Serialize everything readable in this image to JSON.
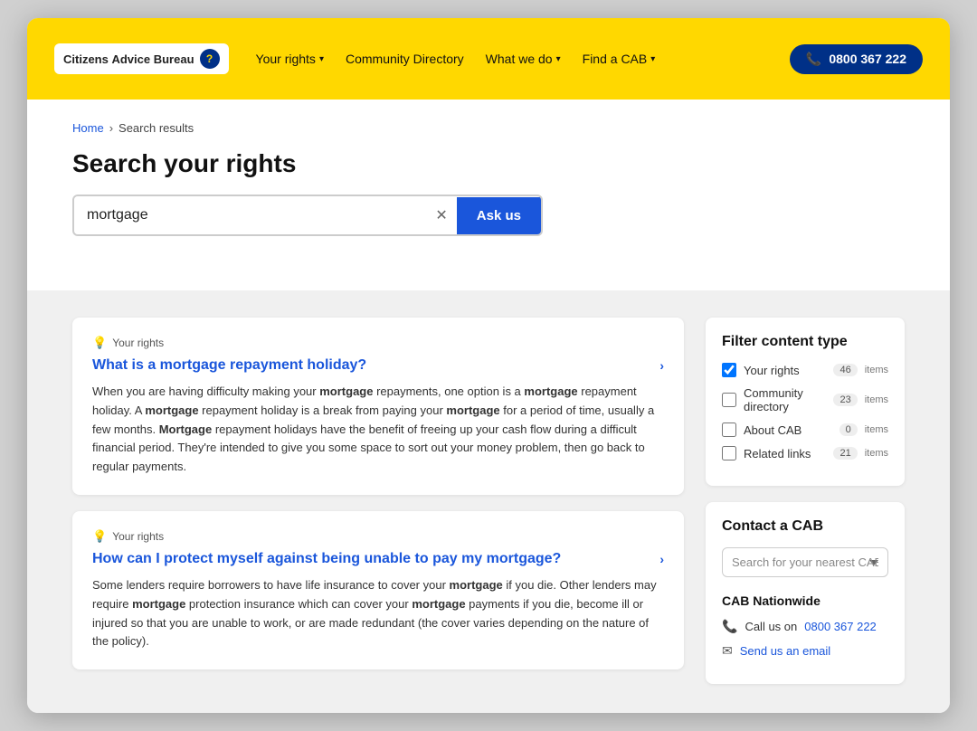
{
  "logo": {
    "name": "Citizens Advice Bureau",
    "icon_char": "?",
    "parts": [
      "Citizens ",
      "Advice ",
      "Bureau"
    ]
  },
  "nav": {
    "items": [
      {
        "id": "your-rights",
        "label": "Your rights",
        "has_dropdown": true
      },
      {
        "id": "community-directory",
        "label": "Community Directory",
        "has_dropdown": false
      },
      {
        "id": "what-we-do",
        "label": "What we do",
        "has_dropdown": true
      },
      {
        "id": "find-a-cab",
        "label": "Find a CAB",
        "has_dropdown": true
      }
    ],
    "phone": {
      "label": "0800 367 222",
      "display": "📞 0800 367 222"
    }
  },
  "breadcrumb": {
    "home": "Home",
    "separator": "›",
    "current": "Search results"
  },
  "search": {
    "title": "Search your rights",
    "value": "mortgage",
    "clear_label": "✕",
    "button_label": "Ask us"
  },
  "results": [
    {
      "tag": "Your rights",
      "title": "What is a mortgage repayment holiday?",
      "body_html": "When you are having difficulty making your <strong>mortgage</strong> repayments, one option is a <strong>mortgage</strong> repayment holiday. A <strong>mortgage</strong> repayment holiday is a break from paying your <strong>mortgage</strong> for a period of time, usually a few months. <strong>Mortgage</strong> repayment holidays have the benefit of freeing up your cash flow during a difficult financial period. They're intended to give you some space to sort out your money problem, then go back to regular payments."
    },
    {
      "tag": "Your rights",
      "title": "How can I protect myself against being unable to pay my mortgage?",
      "body_html": "Some lenders require borrowers to have life insurance to cover your <strong>mortgage</strong> if you die. Other lenders may require <strong>mortgage</strong> protection insurance which can cover your <strong>mortgage</strong> payments if you die, become ill or injured so that you are unable to work, or are made redundant (the cover varies depending on the nature of the policy)."
    }
  ],
  "filter": {
    "title": "Filter content type",
    "items": [
      {
        "label": "Your rights",
        "count": "46",
        "count_label": "items",
        "checked": true
      },
      {
        "label": "Community directory",
        "count": "23",
        "count_label": "items",
        "checked": false
      },
      {
        "label": "About CAB",
        "count": "0",
        "count_label": "items",
        "checked": false
      },
      {
        "label": "Related links",
        "count": "21",
        "count_label": "items",
        "checked": false
      }
    ]
  },
  "contact": {
    "title": "Contact a CAB",
    "search_placeholder": "Search for your nearest CAB",
    "nationwide_title": "CAB Nationwide",
    "phone_label": "Call us on",
    "phone_number": "0800 367 222",
    "email_label": "Send us an email"
  }
}
